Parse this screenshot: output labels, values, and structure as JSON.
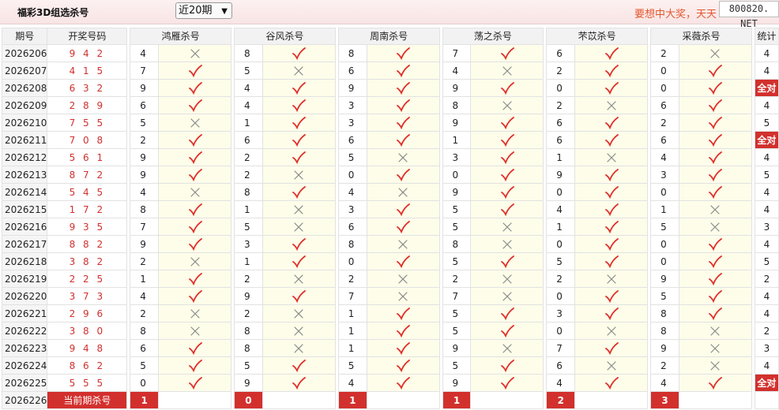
{
  "header": {
    "title": "福彩3D组选杀号",
    "period_select": "近20期",
    "marquee": "要想中大奖，天天",
    "watermark": "800820. NET"
  },
  "table": {
    "headers": {
      "issue": "期号",
      "draw": "开奖号码",
      "experts": [
        "鸿雁杀号",
        "谷风杀号",
        "周南杀号",
        "荡之杀号",
        "芣苡杀号",
        "采薇杀号"
      ],
      "stat": "统计"
    },
    "rows": [
      {
        "issue": "2026206",
        "draw": "9 4 2",
        "picks": [
          {
            "n": "4",
            "ok": false
          },
          {
            "n": "8",
            "ok": true
          },
          {
            "n": "8",
            "ok": true
          },
          {
            "n": "7",
            "ok": true
          },
          {
            "n": "6",
            "ok": true
          },
          {
            "n": "2",
            "ok": false
          }
        ],
        "stat": "4"
      },
      {
        "issue": "2026207",
        "draw": "4 1 5",
        "picks": [
          {
            "n": "7",
            "ok": true
          },
          {
            "n": "5",
            "ok": false
          },
          {
            "n": "6",
            "ok": true
          },
          {
            "n": "4",
            "ok": false
          },
          {
            "n": "2",
            "ok": true
          },
          {
            "n": "0",
            "ok": true
          }
        ],
        "stat": "4"
      },
      {
        "issue": "2026208",
        "draw": "6 3 2",
        "picks": [
          {
            "n": "9",
            "ok": true
          },
          {
            "n": "4",
            "ok": true
          },
          {
            "n": "9",
            "ok": true
          },
          {
            "n": "9",
            "ok": true
          },
          {
            "n": "0",
            "ok": true
          },
          {
            "n": "0",
            "ok": true
          }
        ],
        "stat": "全对"
      },
      {
        "issue": "2026209",
        "draw": "2 8 9",
        "picks": [
          {
            "n": "6",
            "ok": true
          },
          {
            "n": "4",
            "ok": true
          },
          {
            "n": "3",
            "ok": true
          },
          {
            "n": "8",
            "ok": false
          },
          {
            "n": "2",
            "ok": false
          },
          {
            "n": "6",
            "ok": true
          }
        ],
        "stat": "4"
      },
      {
        "issue": "2026210",
        "draw": "7 5 5",
        "picks": [
          {
            "n": "5",
            "ok": false
          },
          {
            "n": "1",
            "ok": true
          },
          {
            "n": "3",
            "ok": true
          },
          {
            "n": "9",
            "ok": true
          },
          {
            "n": "6",
            "ok": true
          },
          {
            "n": "2",
            "ok": true
          }
        ],
        "stat": "5"
      },
      {
        "issue": "2026211",
        "draw": "7 0 8",
        "picks": [
          {
            "n": "2",
            "ok": true
          },
          {
            "n": "6",
            "ok": true
          },
          {
            "n": "6",
            "ok": true
          },
          {
            "n": "1",
            "ok": true
          },
          {
            "n": "6",
            "ok": true
          },
          {
            "n": "6",
            "ok": true
          }
        ],
        "stat": "全对"
      },
      {
        "issue": "2026212",
        "draw": "5 6 1",
        "picks": [
          {
            "n": "9",
            "ok": true
          },
          {
            "n": "2",
            "ok": true
          },
          {
            "n": "5",
            "ok": false
          },
          {
            "n": "3",
            "ok": true
          },
          {
            "n": "1",
            "ok": false
          },
          {
            "n": "4",
            "ok": true
          }
        ],
        "stat": "4"
      },
      {
        "issue": "2026213",
        "draw": "8 7 2",
        "picks": [
          {
            "n": "9",
            "ok": true
          },
          {
            "n": "2",
            "ok": false
          },
          {
            "n": "0",
            "ok": true
          },
          {
            "n": "0",
            "ok": true
          },
          {
            "n": "9",
            "ok": true
          },
          {
            "n": "3",
            "ok": true
          }
        ],
        "stat": "5"
      },
      {
        "issue": "2026214",
        "draw": "5 4 5",
        "picks": [
          {
            "n": "4",
            "ok": false
          },
          {
            "n": "8",
            "ok": true
          },
          {
            "n": "4",
            "ok": false
          },
          {
            "n": "9",
            "ok": true
          },
          {
            "n": "0",
            "ok": true
          },
          {
            "n": "0",
            "ok": true
          }
        ],
        "stat": "4"
      },
      {
        "issue": "2026215",
        "draw": "1 7 2",
        "picks": [
          {
            "n": "8",
            "ok": true
          },
          {
            "n": "1",
            "ok": false
          },
          {
            "n": "3",
            "ok": true
          },
          {
            "n": "5",
            "ok": true
          },
          {
            "n": "4",
            "ok": true
          },
          {
            "n": "1",
            "ok": false
          }
        ],
        "stat": "4"
      },
      {
        "issue": "2026216",
        "draw": "9 3 5",
        "picks": [
          {
            "n": "7",
            "ok": true
          },
          {
            "n": "5",
            "ok": false
          },
          {
            "n": "6",
            "ok": true
          },
          {
            "n": "5",
            "ok": false
          },
          {
            "n": "1",
            "ok": true
          },
          {
            "n": "5",
            "ok": false
          }
        ],
        "stat": "3"
      },
      {
        "issue": "2026217",
        "draw": "8 8 2",
        "picks": [
          {
            "n": "9",
            "ok": true
          },
          {
            "n": "3",
            "ok": true
          },
          {
            "n": "8",
            "ok": false
          },
          {
            "n": "8",
            "ok": false
          },
          {
            "n": "0",
            "ok": true
          },
          {
            "n": "0",
            "ok": true
          }
        ],
        "stat": "4"
      },
      {
        "issue": "2026218",
        "draw": "3 8 2",
        "picks": [
          {
            "n": "2",
            "ok": false
          },
          {
            "n": "1",
            "ok": true
          },
          {
            "n": "0",
            "ok": true
          },
          {
            "n": "5",
            "ok": true
          },
          {
            "n": "5",
            "ok": true
          },
          {
            "n": "0",
            "ok": true
          }
        ],
        "stat": "5"
      },
      {
        "issue": "2026219",
        "draw": "2 2 5",
        "picks": [
          {
            "n": "1",
            "ok": true
          },
          {
            "n": "2",
            "ok": false
          },
          {
            "n": "2",
            "ok": false
          },
          {
            "n": "2",
            "ok": false
          },
          {
            "n": "2",
            "ok": false
          },
          {
            "n": "9",
            "ok": true
          }
        ],
        "stat": "2"
      },
      {
        "issue": "2026220",
        "draw": "3 7 3",
        "picks": [
          {
            "n": "4",
            "ok": true
          },
          {
            "n": "9",
            "ok": true
          },
          {
            "n": "7",
            "ok": false
          },
          {
            "n": "7",
            "ok": false
          },
          {
            "n": "0",
            "ok": true
          },
          {
            "n": "5",
            "ok": true
          }
        ],
        "stat": "4"
      },
      {
        "issue": "2026221",
        "draw": "2 9 6",
        "picks": [
          {
            "n": "2",
            "ok": false
          },
          {
            "n": "2",
            "ok": false
          },
          {
            "n": "1",
            "ok": true
          },
          {
            "n": "5",
            "ok": true
          },
          {
            "n": "3",
            "ok": true
          },
          {
            "n": "8",
            "ok": true
          }
        ],
        "stat": "4"
      },
      {
        "issue": "2026222",
        "draw": "3 8 0",
        "picks": [
          {
            "n": "8",
            "ok": false
          },
          {
            "n": "8",
            "ok": false
          },
          {
            "n": "1",
            "ok": true
          },
          {
            "n": "5",
            "ok": true
          },
          {
            "n": "0",
            "ok": false
          },
          {
            "n": "8",
            "ok": false
          }
        ],
        "stat": "2"
      },
      {
        "issue": "2026223",
        "draw": "9 4 8",
        "picks": [
          {
            "n": "6",
            "ok": true
          },
          {
            "n": "8",
            "ok": false
          },
          {
            "n": "1",
            "ok": true
          },
          {
            "n": "9",
            "ok": false
          },
          {
            "n": "7",
            "ok": true
          },
          {
            "n": "9",
            "ok": false
          }
        ],
        "stat": "3"
      },
      {
        "issue": "2026224",
        "draw": "8 6 2",
        "picks": [
          {
            "n": "5",
            "ok": true
          },
          {
            "n": "5",
            "ok": true
          },
          {
            "n": "5",
            "ok": true
          },
          {
            "n": "5",
            "ok": true
          },
          {
            "n": "6",
            "ok": false
          },
          {
            "n": "2",
            "ok": false
          }
        ],
        "stat": "4"
      },
      {
        "issue": "2026225",
        "draw": "5 5 5",
        "picks": [
          {
            "n": "0",
            "ok": true
          },
          {
            "n": "9",
            "ok": true
          },
          {
            "n": "4",
            "ok": true
          },
          {
            "n": "9",
            "ok": true
          },
          {
            "n": "4",
            "ok": true
          },
          {
            "n": "4",
            "ok": true
          }
        ],
        "stat": "全对"
      }
    ],
    "current": {
      "issue": "2026226",
      "label": "当前期杀号",
      "picks": [
        "1",
        "0",
        "1",
        "1",
        "2",
        "3"
      ]
    }
  },
  "icons": {
    "ok": "check-icon",
    "fail": "cross-icon"
  },
  "colors": {
    "accent_red": "#d2302d",
    "check": "#e0302a",
    "cross": "#8a8a8a",
    "mark_bg": "#fdfdea"
  }
}
